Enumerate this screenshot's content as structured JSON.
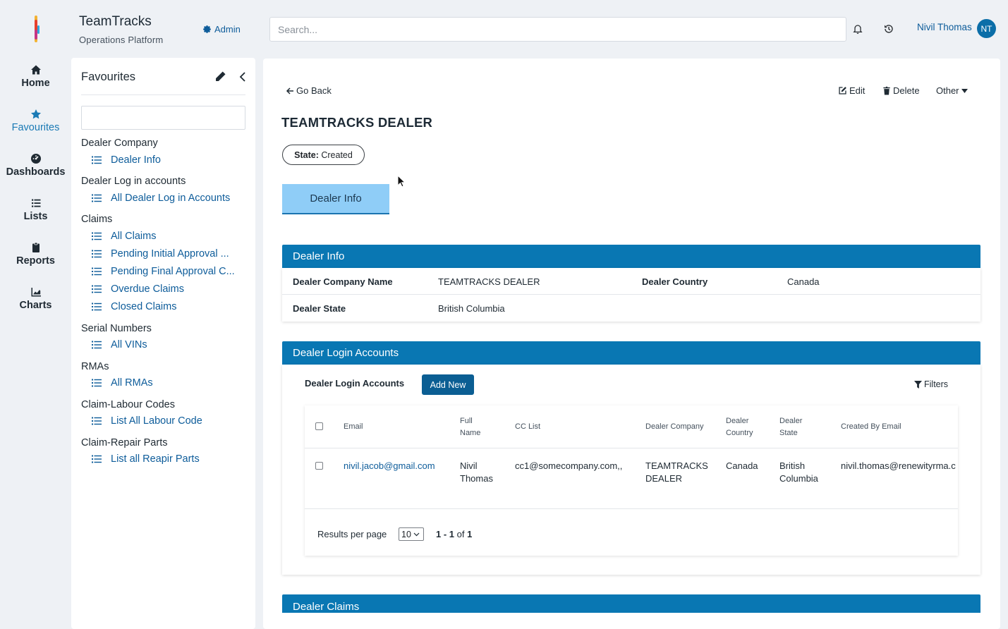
{
  "app": {
    "title": "TeamTracks",
    "subtitle": "Operations Platform",
    "admin_label": "Admin"
  },
  "search": {
    "placeholder": "Search..."
  },
  "header_icons": [
    "bell-icon",
    "history-icon"
  ],
  "user": {
    "name": "Nivil Thomas",
    "initials": "NT"
  },
  "rail": [
    {
      "label": "Home",
      "icon": "home-icon"
    },
    {
      "label": "Favourites",
      "icon": "star-icon",
      "active": true
    },
    {
      "label": "Dashboards",
      "icon": "dashboard-icon"
    },
    {
      "label": "Lists",
      "icon": "list-icon"
    },
    {
      "label": "Reports",
      "icon": "clipboard-icon"
    },
    {
      "label": "Charts",
      "icon": "chart-icon"
    }
  ],
  "favourites": {
    "title": "Favourites",
    "groups": [
      {
        "name": "Dealer Company",
        "links": [
          "Dealer Info"
        ]
      },
      {
        "name": "Dealer Log in accounts",
        "links": [
          "All Dealer Log in Accounts"
        ]
      },
      {
        "name": "Claims",
        "links": [
          "All Claims",
          "Pending Initial Approval ...",
          "Pending Final Approval C...",
          "Overdue Claims",
          "Closed Claims"
        ]
      },
      {
        "name": "Serial Numbers",
        "links": [
          "All VINs"
        ]
      },
      {
        "name": "RMAs",
        "links": [
          "All RMAs"
        ]
      },
      {
        "name": "Claim-Labour Codes",
        "links": [
          "List All Labour Code"
        ]
      },
      {
        "name": "Claim-Repair Parts",
        "links": [
          "List all Reapir Parts"
        ]
      }
    ]
  },
  "record": {
    "go_back": "Go Back",
    "actions": {
      "edit": "Edit",
      "delete": "Delete",
      "other": "Other"
    },
    "title": "TEAMTRACKS DEALER",
    "state_label": "State:",
    "state_value": "Created",
    "tab": "Dealer Info"
  },
  "dealer_info": {
    "heading": "Dealer Info",
    "company_name_label": "Dealer Company Name",
    "company_name": "TEAMTRACKS DEALER",
    "country_label": "Dealer Country",
    "country": "Canada",
    "state_label": "Dealer State",
    "state": "British Columbia"
  },
  "login_accounts": {
    "heading": "Dealer Login Accounts",
    "toolbar_title": "Dealer Login Accounts",
    "add_new": "Add New",
    "filters": "Filters",
    "columns": {
      "email": "Email",
      "full_name": [
        "Full",
        "Name"
      ],
      "cc_list": "CC List",
      "company": "Dealer Company",
      "country": [
        "Dealer",
        "Country"
      ],
      "state": [
        "Dealer",
        "State"
      ],
      "created_by": "Created By Email"
    },
    "rows": [
      {
        "email": "nivil.jacob@gmail.com",
        "full_name": [
          "Nivil",
          "Thomas"
        ],
        "cc_list": "cc1@somecompany.com,,",
        "company": [
          "TEAMTRACKS",
          "DEALER"
        ],
        "country": "Canada",
        "state": [
          "British",
          "Columbia"
        ],
        "created_by": "nivil.thomas@renewityrma.c"
      }
    ],
    "results_per_page_label": "Results per page",
    "results_per_page": "10",
    "range": "1 - 1",
    "range_of": "of",
    "total": "1"
  },
  "dealer_claims": {
    "heading": "Dealer Claims"
  }
}
